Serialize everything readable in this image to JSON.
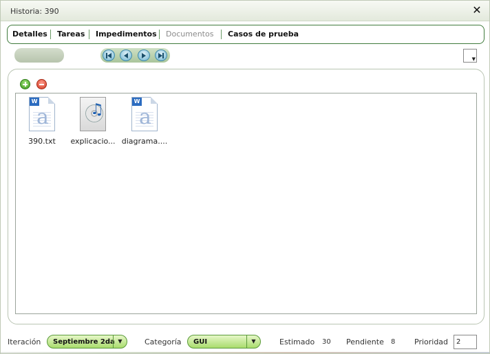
{
  "window": {
    "title": "Historia: 390",
    "close_glyph": "✕"
  },
  "tabs": [
    {
      "label": "Detalles",
      "active": true
    },
    {
      "label": "Tareas",
      "active": true
    },
    {
      "label": "Impedimentos",
      "active": true
    },
    {
      "label": "Documentos",
      "active": false
    },
    {
      "label": "Casos de prueba",
      "active": true
    }
  ],
  "toolbar": {
    "nav_icons": [
      "first-page-icon",
      "previous-page-icon",
      "next-page-icon",
      "last-page-icon"
    ]
  },
  "documents": {
    "actions": {
      "add_icon": "add-icon",
      "remove_icon": "remove-icon"
    },
    "files": [
      {
        "name": "390.txt",
        "icon": "text-document-icon"
      },
      {
        "name": "explicacio...",
        "icon": "audio-file-icon"
      },
      {
        "name": "diagrama....",
        "icon": "text-document-icon"
      }
    ]
  },
  "footer": {
    "iteracion_label": "Iteración",
    "iteracion_value": "Septiembre 2da",
    "categoria_label": "Categoría",
    "categoria_value": "GUI",
    "estimado_label": "Estimado",
    "estimado_value": "30",
    "pendiente_label": "Pendiente",
    "pendiente_value": "8",
    "prioridad_label": "Prioridad",
    "prioridad_value": "2"
  },
  "colors": {
    "accent_green": "#3e7a3a",
    "combo_green": "#a9dc6d",
    "nav_blue": "#6fb5d1"
  }
}
